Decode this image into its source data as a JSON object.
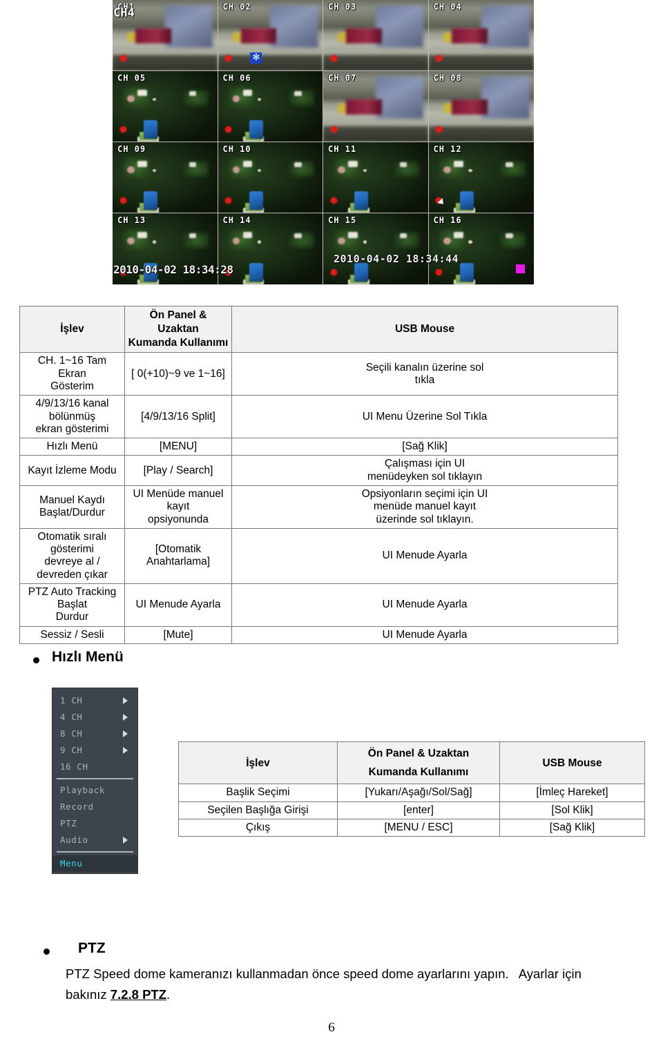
{
  "dvr_screenshot": {
    "name": "16-channel live view",
    "channels": [
      {
        "label": "CH1",
        "overlay_label": "CH4",
        "scene": "indoor",
        "recording": true
      },
      {
        "label": "CH 02",
        "scene": "indoor",
        "recording": true,
        "motion_icon": true
      },
      {
        "label": "CH 03",
        "scene": "indoor",
        "recording": true
      },
      {
        "label": "CH 04",
        "scene": "indoor",
        "recording": true
      },
      {
        "label": "CH 05",
        "scene": "dark",
        "recording": true
      },
      {
        "label": "CH 06",
        "scene": "dark",
        "recording": true
      },
      {
        "label": "CH 07",
        "scene": "indoor",
        "recording": true
      },
      {
        "label": "CH 08",
        "scene": "indoor",
        "recording": true
      },
      {
        "label": "CH 09",
        "scene": "dark",
        "recording": true
      },
      {
        "label": "CH 10",
        "scene": "dark",
        "recording": true
      },
      {
        "label": "CH 11",
        "scene": "dark",
        "recording": true
      },
      {
        "label": "CH 12",
        "scene": "dark",
        "recording": true
      },
      {
        "label": "CH 13",
        "scene": "dark",
        "recording": true
      },
      {
        "label": "CH 14",
        "scene": "dark",
        "recording": true
      },
      {
        "label": "CH 15",
        "scene": "dark",
        "recording": true
      },
      {
        "label": "CH 16",
        "scene": "dark",
        "recording": true
      }
    ],
    "osd_time_left": "2010-04-02 18:34:28",
    "osd_time_right": "2010-04-02 18:34:44",
    "motion_icon_glyph": "✻",
    "marker_color": "#e81ae8",
    "rec_dot_color": "#e21b16"
  },
  "table_shortcuts": {
    "headers": {
      "function": "İşlev",
      "panel_line1": "Ön Panel & Uzaktan",
      "panel_line2": "Kumanda Kullanımı",
      "mouse": "USB Mouse"
    },
    "rows": [
      {
        "function_line1": "CH. 1~16 Tam Ekran",
        "function_line2": "Gösterim",
        "panel": "[ 0(+10)~9 ve 1~16]",
        "mouse_line1": "Seçili kanalın üzerine sol",
        "mouse_line2": "tıkla"
      },
      {
        "function_line1": "4/9/13/16 kanal bölünmüş",
        "function_line2": "ekran gösterimi",
        "panel": "[4/9/13/16 Split]",
        "mouse_line1": "UI Menu Üzerine Sol Tıkla",
        "mouse_line2": ""
      },
      {
        "function_line1": "Hızlı Menü",
        "function_line2": "",
        "panel": "[MENU]",
        "mouse_line1": "[Sağ Klik]",
        "mouse_line2": ""
      },
      {
        "function_line1": "Kayıt İzleme Modu",
        "function_line2": "",
        "panel": "[Play / Search]",
        "mouse_line1": "Çalışması için UI",
        "mouse_line2": "menüdeyken sol tıklayın"
      },
      {
        "function_line1": "Manuel Kaydı",
        "function_line2": "Başlat/Durdur",
        "panel_line1": "UI Menüde manuel kayıt",
        "panel_line2": "opsiyonunda",
        "mouse_line1": "Opsiyonların seçimi için UI",
        "mouse_line2": "menüde manuel kayıt",
        "mouse_line3": "üzerinde sol tıklayın."
      },
      {
        "function_line1": "Otomatik sıralı gösterimi",
        "function_line2": "devreye al / devreden çıkar",
        "panel": "[Otomatik Anahtarlama]",
        "mouse_line1": "UI Menude Ayarla",
        "mouse_line2": ""
      },
      {
        "function_line1": "PTZ Auto Tracking Başlat",
        "function_line2": "Durdur",
        "panel": "UI Menude Ayarla",
        "mouse_line1": "UI Menude Ayarla",
        "mouse_line2": ""
      },
      {
        "function_line1": "Sessiz / Sesli",
        "function_line2": "",
        "panel": "[Mute]",
        "mouse_line1": "UI Menude Ayarla",
        "mouse_line2": ""
      }
    ]
  },
  "quick_menu_heading": "Hızlı Menü",
  "quick_menu_screenshot": {
    "items": [
      {
        "label": "1  CH",
        "has_arrow": true,
        "selected": false
      },
      {
        "label": "4  CH",
        "has_arrow": true,
        "selected": false
      },
      {
        "label": "8  CH",
        "has_arrow": true,
        "selected": false
      },
      {
        "label": "9  CH",
        "has_arrow": true,
        "selected": false
      },
      {
        "label": "16  CH",
        "has_arrow": false,
        "selected": false
      },
      {
        "label": "Playback",
        "has_arrow": false,
        "selected": false
      },
      {
        "label": "Record",
        "has_arrow": false,
        "selected": false
      },
      {
        "label": "PTZ",
        "has_arrow": false,
        "selected": false
      },
      {
        "label": "Audio",
        "has_arrow": true,
        "selected": false
      },
      {
        "label": "Menu",
        "has_arrow": false,
        "selected": true
      }
    ],
    "selected_color": "#36d6e8",
    "background_color": "#3d444c"
  },
  "table_menu_nav": {
    "headers": {
      "function": "İşlev",
      "panel_line1": "Ön Panel & Uzaktan",
      "panel_line2": "Kumanda Kullanımı",
      "mouse": "USB Mouse"
    },
    "rows": [
      {
        "function": "Başlik Seçimi",
        "panel": "[Yukarı/Aşağı/Sol/Sağ]",
        "mouse": "[İmleç Hareket]"
      },
      {
        "function": "Seçilen Başlığa Girişi",
        "panel": "[enter]",
        "mouse": "[Sol Klik]"
      },
      {
        "function": "Çıkış",
        "panel": "[MENU / ESC]",
        "mouse": "[Sağ Klik]"
      }
    ]
  },
  "ptz_section": {
    "heading": "PTZ",
    "paragraph_part1": "PTZ Speed dome kameranızı kullanmadan önce speed dome ayarlarını yapın.",
    "paragraph_part2": "Ayarlar için bakınız ",
    "reference": "7.2.8 PTZ",
    "paragraph_end": "."
  },
  "page_number": "6"
}
